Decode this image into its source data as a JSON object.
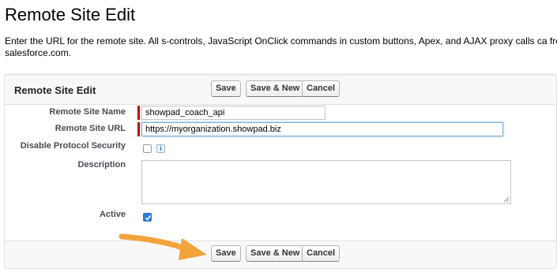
{
  "page": {
    "title": "Remote Site Edit",
    "intro": "Enter the URL for the remote site. All s-controls, JavaScript OnClick commands in custom buttons, Apex, and AJAX proxy calls ca from salesforce.com."
  },
  "panel": {
    "title": "Remote Site Edit",
    "top_buttons": {
      "save": "Save",
      "save_new": "Save & New",
      "cancel": "Cancel"
    },
    "bottom_buttons": {
      "save": "Save",
      "save_new": "Save & New",
      "cancel": "Cancel"
    }
  },
  "form": {
    "remote_site_name": {
      "label": "Remote Site Name",
      "value": "showpad_coach_api",
      "required": true
    },
    "remote_site_url": {
      "label": "Remote Site URL",
      "value": "https://myorganization.showpad.biz",
      "required": true,
      "focused": true
    },
    "disable_protocol_security": {
      "label": "Disable Protocol Security",
      "checked": false,
      "info_glyph": "i"
    },
    "description": {
      "label": "Description",
      "value": ""
    },
    "active": {
      "label": "Active",
      "checked": true
    }
  },
  "colors": {
    "required_marker": "#cc0000",
    "checkbox_checked": "#2e7ddc",
    "annotation_arrow": "#f2a33a"
  },
  "annotation": {
    "icon": "arrow-right-icon",
    "points_to": "bottom-save-button"
  }
}
